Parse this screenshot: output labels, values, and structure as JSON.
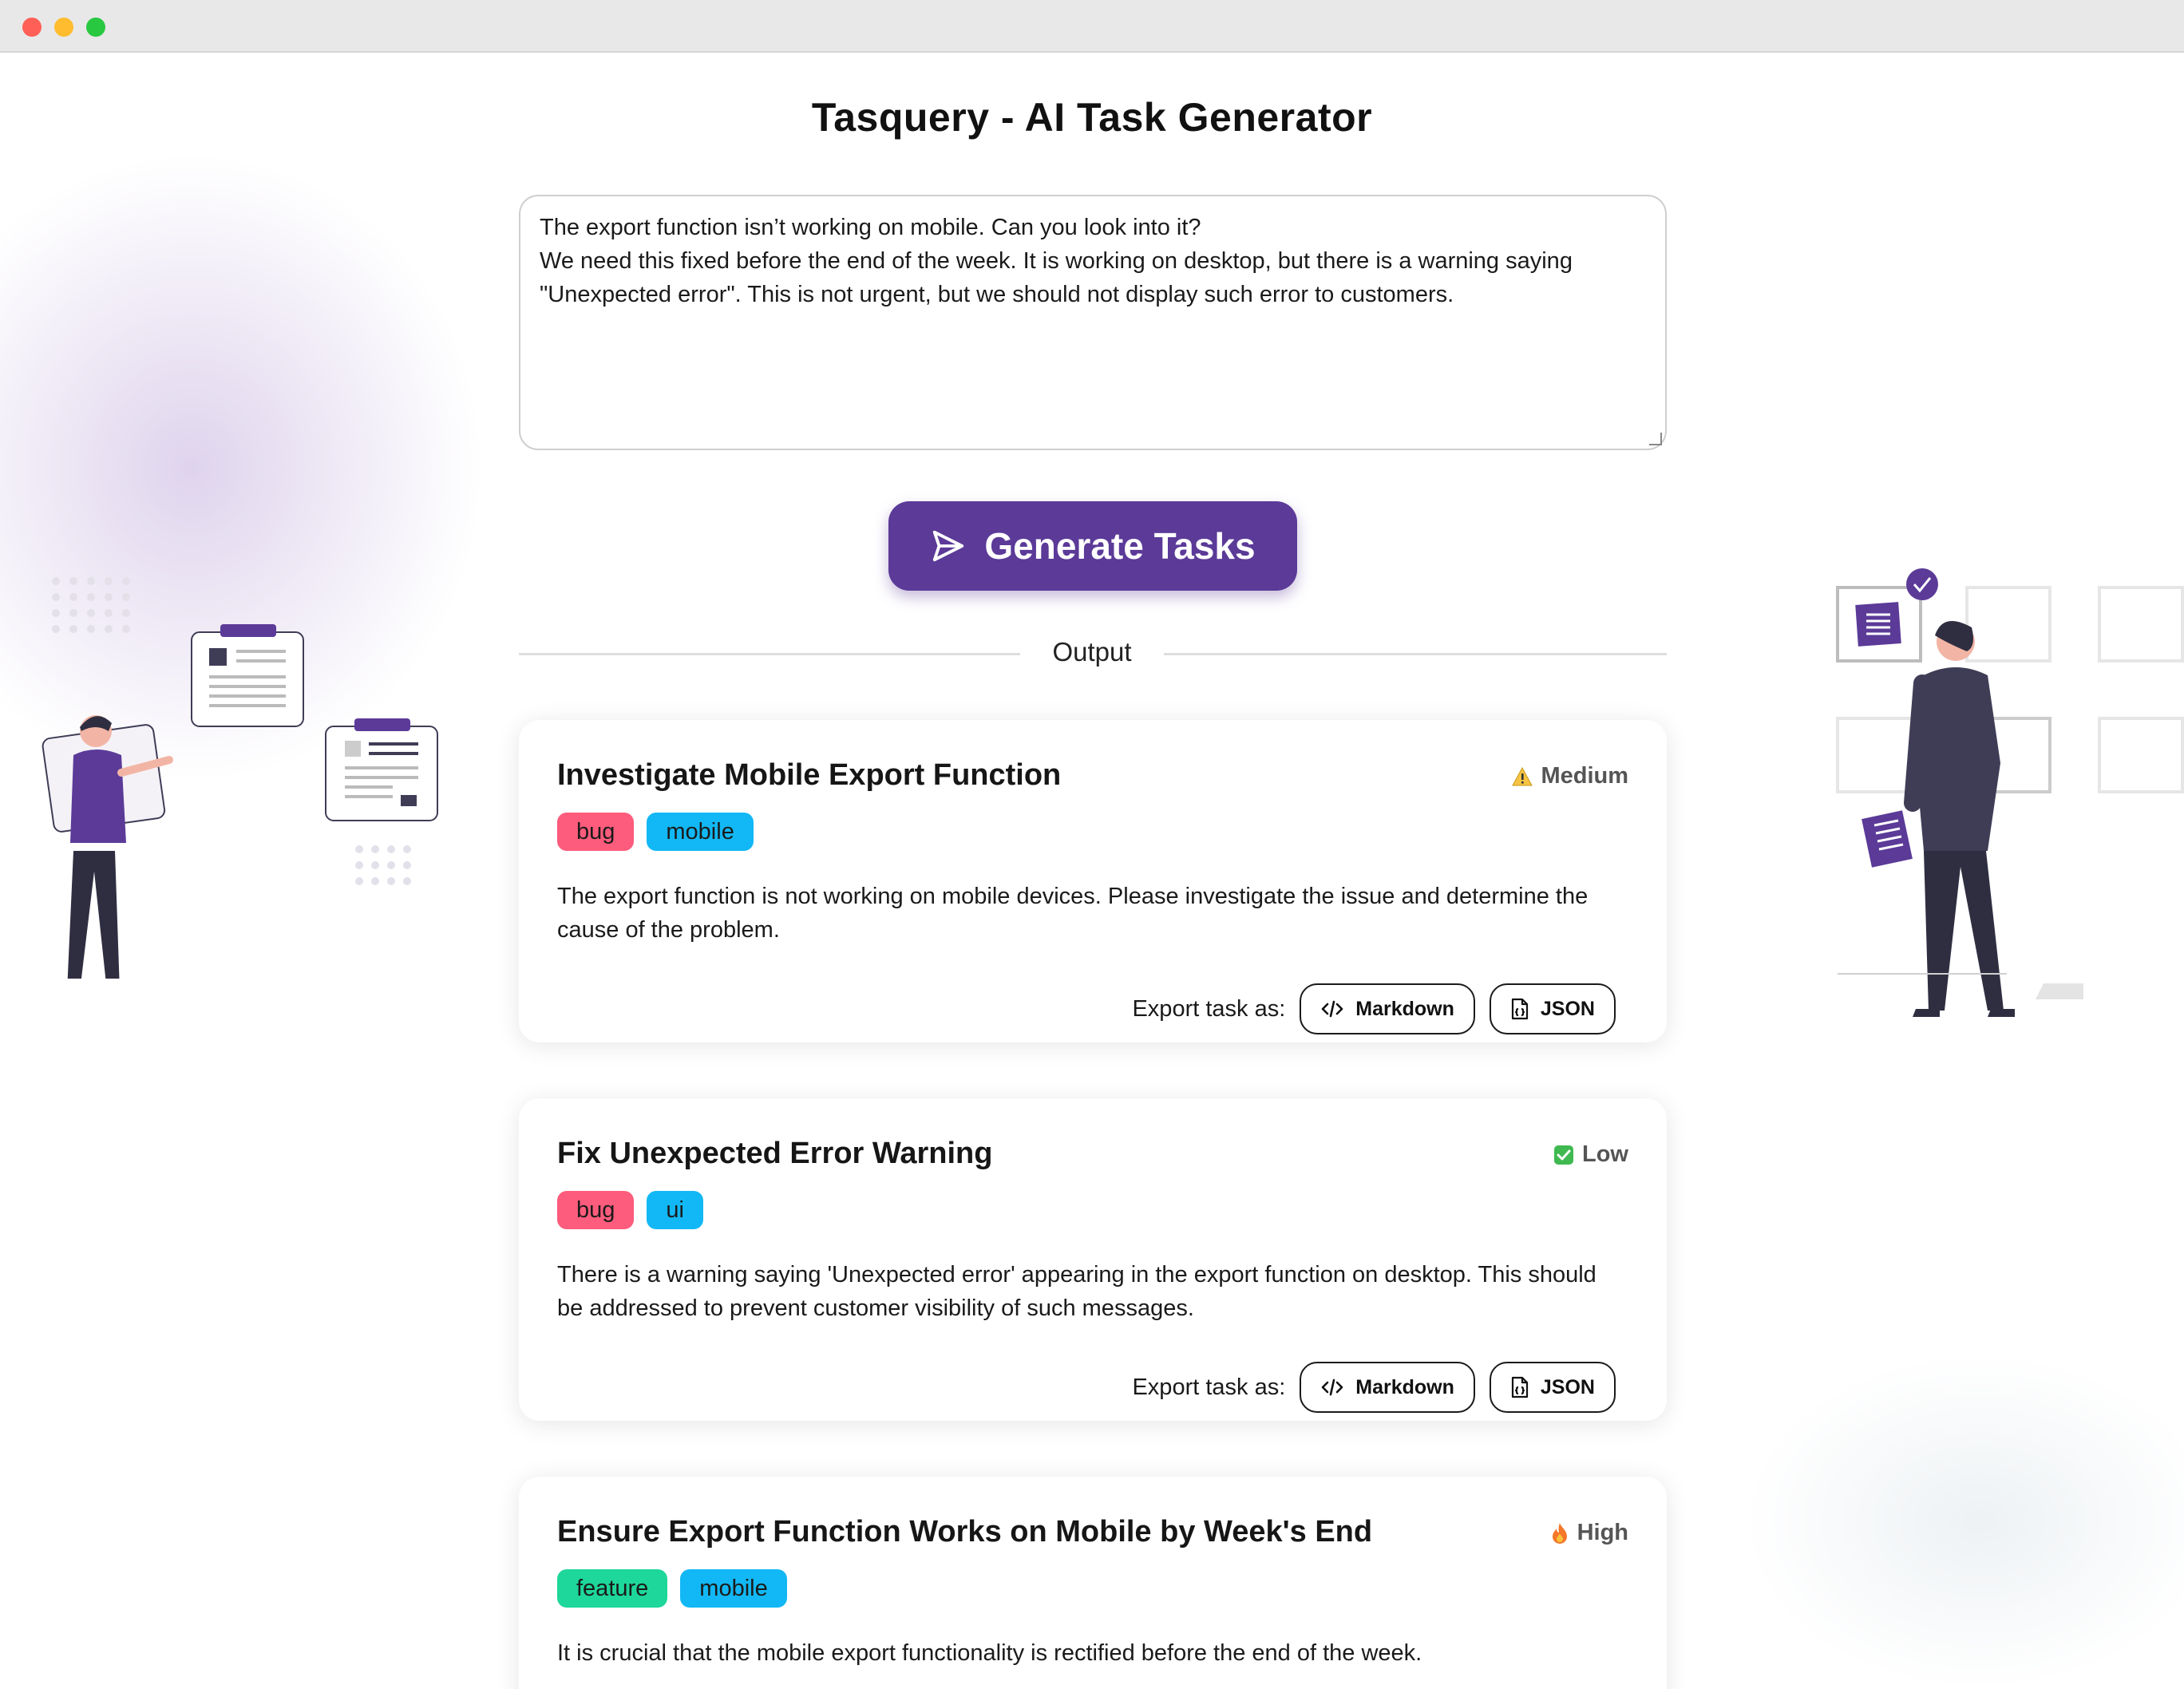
{
  "window": {
    "controls": [
      "close",
      "minimize",
      "maximize"
    ]
  },
  "app": {
    "title": "Tasquery - AI Task Generator"
  },
  "prompt": {
    "value": "The export function isn’t working on mobile. Can you look into it?\nWe need this fixed before the end of the week. It is working on desktop, but there is a warning saying \"Unexpected error\". This is not urgent, but we should not display such error to customers."
  },
  "generate_button": {
    "label": "Generate Tasks",
    "icon": "send-icon"
  },
  "output": {
    "label": "Output"
  },
  "export": {
    "label": "Export task as:",
    "markdown": "Markdown",
    "json": "JSON"
  },
  "tasks": [
    {
      "title": "Investigate Mobile Export Function",
      "priority": "Medium",
      "priority_icon": "warning-icon",
      "tags": [
        "bug",
        "mobile"
      ],
      "description": "The export function is not working on mobile devices. Please investigate the issue and determine the cause of the problem."
    },
    {
      "title": "Fix Unexpected Error Warning",
      "priority": "Low",
      "priority_icon": "check-icon",
      "tags": [
        "bug",
        "ui"
      ],
      "description": "There is a warning saying 'Unexpected error' appearing in the export function on desktop. This should be addressed to prevent customer visibility of such messages."
    },
    {
      "title": "Ensure Export Function Works on Mobile by Week's End",
      "priority": "High",
      "priority_icon": "fire-icon",
      "tags": [
        "feature",
        "mobile"
      ],
      "description": "It is crucial that the mobile export functionality is rectified before the end of the week."
    }
  ],
  "colors": {
    "accent": "#5b3a98",
    "tag_bug": "#fd5c7c",
    "tag_mobile": "#12b8f5",
    "tag_ui": "#12b8f5",
    "tag_feature": "#1ed79a"
  }
}
